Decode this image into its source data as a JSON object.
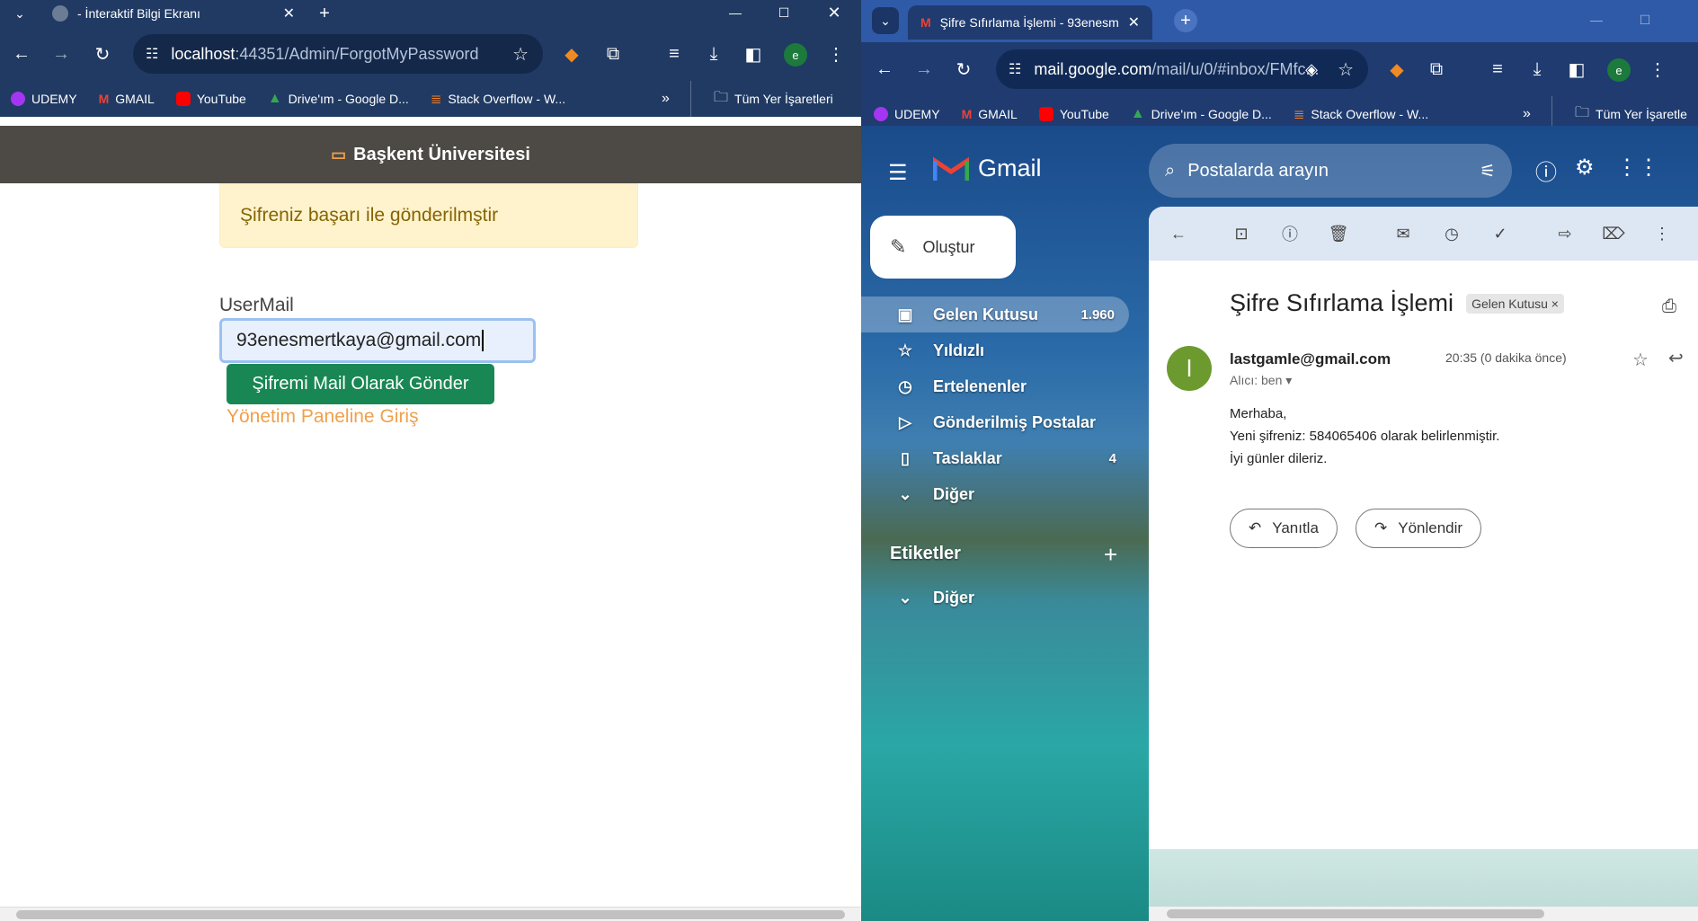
{
  "left": {
    "tab_title": "- İnteraktif Bilgi Ekranı",
    "url_host": "localhost",
    "url_path": ":44351/Admin/ForgotMyPassword",
    "profile_initial": "e",
    "bookmarks": [
      "UDEMY",
      "GMAIL",
      "YouTube",
      "Drive'ım - Google D...",
      "Stack Overflow - W..."
    ],
    "all_bookmarks": "Tüm Yer İşaretleri",
    "site_title": "Başkent Üniversitesi",
    "alert": "Şifreniz başarı ile gönderilmştir",
    "field_label": "UserMail",
    "field_value": "93enesmertkaya@gmail.com",
    "submit_label": "Şifremi Mail Olarak Gönder",
    "login_link": "Yönetim Paneline Giriş"
  },
  "right": {
    "tab_title": "Şifre Sıfırlama İşlemi - 93enesm",
    "url_host": "mail.google.com",
    "url_path": "/mail/u/0/#inbox/FMfc...",
    "profile_initial": "e",
    "bookmarks": [
      "UDEMY",
      "GMAIL",
      "YouTube",
      "Drive'ım - Google D...",
      "Stack Overflow - W..."
    ],
    "all_bookmarks": "Tüm Yer İşaretle",
    "gmail_brand": "Gmail",
    "search_placeholder": "Postalarda arayın",
    "compose_label": "Oluştur",
    "nav": [
      {
        "label": "Gelen Kutusu",
        "count": "1.960"
      },
      {
        "label": "Yıldızlı",
        "count": ""
      },
      {
        "label": "Ertelenenler",
        "count": ""
      },
      {
        "label": "Gönderilmiş Postalar",
        "count": ""
      },
      {
        "label": "Taslaklar",
        "count": "4"
      },
      {
        "label": "Diğer",
        "count": ""
      }
    ],
    "labels_heading": "Etiketler",
    "labels_other": "Diğer",
    "email": {
      "subject": "Şifre Sıfırlama İşlemi",
      "folder_chip": "Gelen Kutusu",
      "avatar_initial": "l",
      "from": "lastgamle@gmail.com",
      "to": "Alıcı: ben",
      "time": "20:35 (0 dakika önce)",
      "body_line1": "Merhaba,",
      "body_line2": "Yeni şifreniz: 584065406 olarak belirlenmiştir.",
      "body_line3": "İyi günler dileriz.",
      "reply_label": "Yanıtla",
      "forward_label": "Yönlendir"
    }
  }
}
